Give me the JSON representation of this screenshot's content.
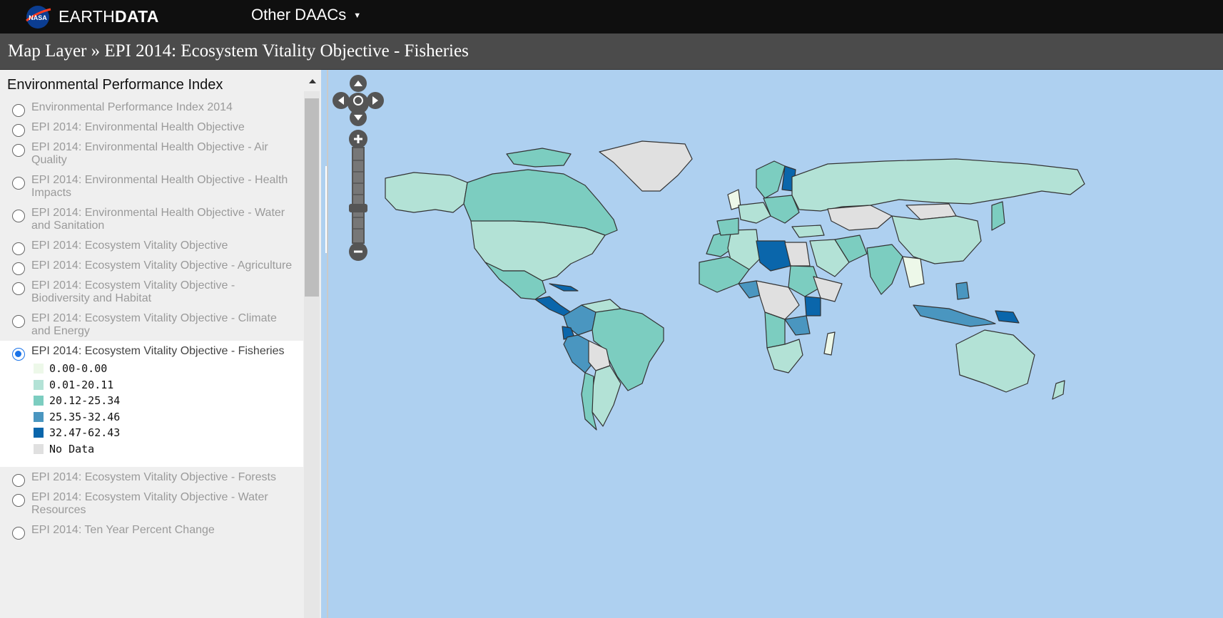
{
  "header": {
    "brand_light": "EARTH",
    "brand_bold": "DATA",
    "daacs_label": "Other DAACs"
  },
  "titlebar": {
    "title": "Map Layer » EPI 2014: Ecosystem Vitality Objective - Fisheries"
  },
  "sidebar": {
    "heading": "Environmental Performance Index",
    "layers": [
      {
        "label": "Environmental Performance Index 2014"
      },
      {
        "label": "EPI 2014: Environmental Health Objective"
      },
      {
        "label": "EPI 2014: Environmental Health Objective - Air Quality"
      },
      {
        "label": "EPI 2014: Environmental Health Objective - Health Impacts"
      },
      {
        "label": "EPI 2014: Environmental Health Objective - Water and Sanitation"
      },
      {
        "label": "EPI 2014: Ecosystem Vitality Objective"
      },
      {
        "label": "EPI 2014: Ecosystem Vitality Objective - Agriculture"
      },
      {
        "label": "EPI 2014: Ecosystem Vitality Objective - Biodiversity and Habitat"
      },
      {
        "label": "EPI 2014: Ecosystem Vitality Objective - Climate and Energy"
      },
      {
        "label": "EPI 2014: Ecosystem Vitality Objective - Fisheries"
      },
      {
        "label": "EPI 2014: Ecosystem Vitality Objective - Forests"
      },
      {
        "label": "EPI 2014: Ecosystem Vitality Objective - Water Resources"
      },
      {
        "label": "EPI 2014: Ten Year Percent Change"
      }
    ],
    "selected_index": 9,
    "legend": [
      {
        "label": "0.00-0.00",
        "color": "#edf8e9"
      },
      {
        "label": "0.01-20.11",
        "color": "#b3e2d6"
      },
      {
        "label": "20.12-25.34",
        "color": "#7ccdc0"
      },
      {
        "label": "25.35-32.46",
        "color": "#4a96c0"
      },
      {
        "label": "32.47-62.43",
        "color": "#0a66ab"
      },
      {
        "label": "No Data",
        "color": "#e0e0e0"
      }
    ]
  },
  "map": {
    "ocean_color": "#aed0f0",
    "zoom_level_fraction": 0.3
  }
}
